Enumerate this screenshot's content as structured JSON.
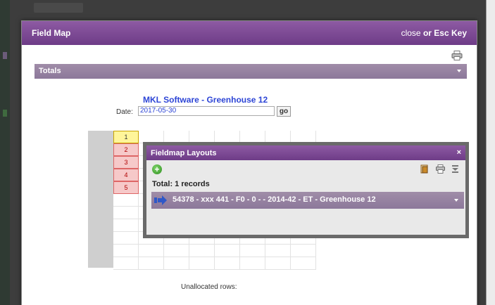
{
  "modal": {
    "title": "Field Map",
    "close_text": "close",
    "close_or": "or",
    "close_key": "Esc Key"
  },
  "totals": {
    "label": "Totals"
  },
  "sheet": {
    "title": "MKL Software - Greenhouse 12",
    "date_label": "Date:",
    "date_value": "2017-05-30",
    "go_label": "go"
  },
  "grid": {
    "rows": [
      "1",
      "2",
      "3",
      "4",
      "5"
    ],
    "unallocated_label": "Unallocated rows:"
  },
  "layouts": {
    "title": "Fieldmap Layouts",
    "close_label": "×",
    "add_label": "+",
    "total_text": "Total: 1 records",
    "records": [
      {
        "text": "54378 - xxx 441 - F0 - 0 - - 2014-42 - ET - Greenhouse 12"
      }
    ]
  },
  "icons": {
    "print": "print-icon",
    "add": "add-icon",
    "export": "export-icon",
    "menu": "menu-icon",
    "arrow": "arrow-right-icon"
  },
  "colors": {
    "header_purple": "#7b4a95",
    "bar_mauve": "#968299",
    "link_blue": "#2d45d6",
    "selected_yellow": "#fff59a",
    "row_red": "#f6c9c9"
  }
}
